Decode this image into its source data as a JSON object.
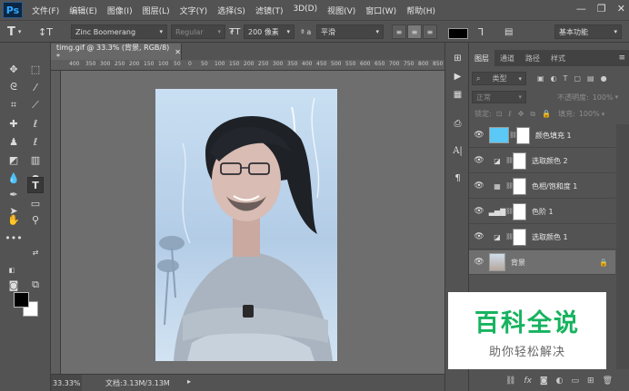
{
  "app": {
    "logo": "Ps"
  },
  "menu": {
    "items": [
      "文件(F)",
      "编辑(E)",
      "图像(I)",
      "图层(L)",
      "文字(Y)",
      "选择(S)",
      "滤镜(T)",
      "3D(D)",
      "视图(V)",
      "窗口(W)",
      "帮助(H)"
    ]
  },
  "window_controls": {
    "minimize": "—",
    "restore": "❐",
    "close": "✕"
  },
  "options": {
    "font_family": "Zinc Boomerang",
    "font_style": "Regular",
    "font_size": "200 像素",
    "aa_label": "ª a",
    "antialias": "平滑",
    "text_color": "#000000",
    "workspace": "基本功能"
  },
  "document": {
    "tab_title": "timg.gif @ 33.3% (背景, RGB/8) *",
    "zoom": "33.33%",
    "doc_info": "文档:3.13M/3.13M",
    "ruler_ticks": [
      "400",
      "350",
      "300",
      "250",
      "200",
      "150",
      "100",
      "50",
      "0",
      "50",
      "100",
      "150",
      "200",
      "250",
      "300",
      "350",
      "400",
      "450",
      "500",
      "550",
      "600",
      "650",
      "700",
      "750",
      "800",
      "850",
      "900"
    ]
  },
  "layers_panel": {
    "tabs": [
      "图层",
      "通道",
      "路径",
      "样式"
    ],
    "filter_kind": "类型",
    "blend_mode": "正常",
    "opacity_label": "不透明度:",
    "opacity_value": "100%",
    "lock_label": "锁定:",
    "fill_label": "填充:",
    "fill_value": "100%",
    "layers": [
      {
        "name": "颜色填充 1",
        "type": "fill",
        "icon": "color-fill-icon"
      },
      {
        "name": "选取颜色 2",
        "type": "selective-color",
        "icon": "selective-color-icon"
      },
      {
        "name": "色相/饱和度 1",
        "type": "hue-saturation",
        "icon": "hue-saturation-icon"
      },
      {
        "name": "色阶 1",
        "type": "levels",
        "icon": "levels-icon"
      },
      {
        "name": "选取颜色 1",
        "type": "selective-color",
        "icon": "selective-color-icon"
      },
      {
        "name": "背景",
        "type": "background",
        "icon": "lock-icon",
        "selected": true
      }
    ]
  },
  "watermark": {
    "title": "百科全说",
    "subtitle": "助你轻松解决"
  },
  "colors": {
    "fill_swatch": "#5bc8f5",
    "watermark_green": "#17b35f"
  }
}
